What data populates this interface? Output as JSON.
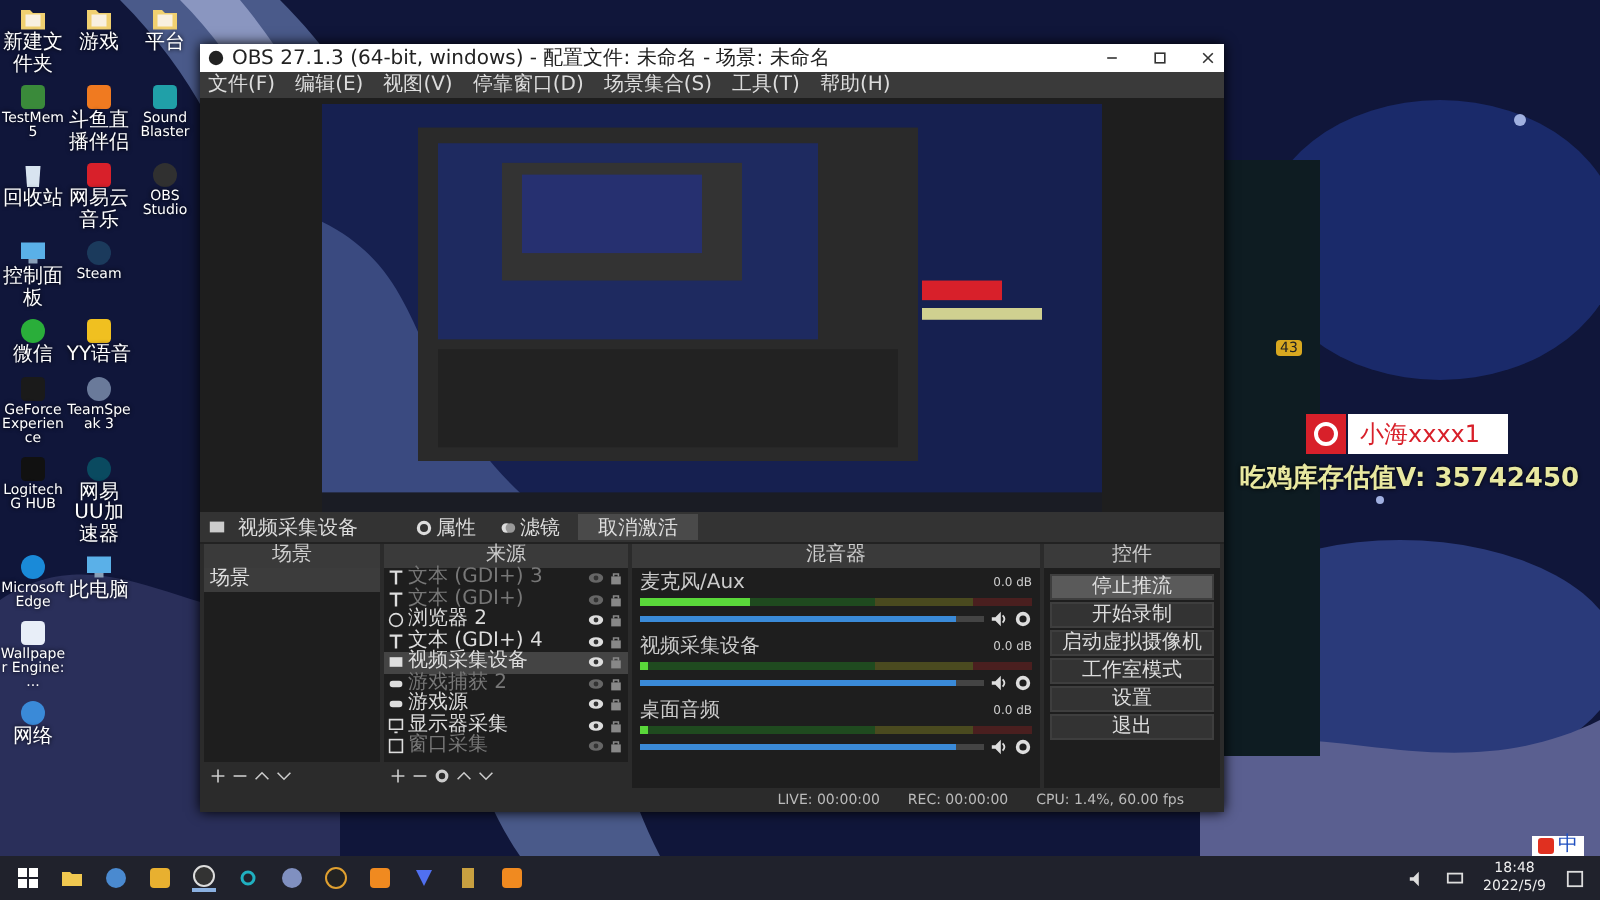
{
  "desktop_rows": [
    [
      {
        "label": "新建文件夹",
        "kind": "folder"
      },
      {
        "label": "游戏",
        "kind": "folder"
      },
      {
        "label": "平台",
        "kind": "folder"
      }
    ],
    [
      {
        "label": "TestMem5",
        "kind": "tile",
        "color": "#3a8a3a"
      },
      {
        "label": "斗鱼直播伴侣",
        "kind": "tile",
        "color": "#f07a20"
      },
      {
        "label": "Sound Blaster",
        "kind": "tile",
        "color": "#20a0a8"
      }
    ],
    [
      {
        "label": "回收站",
        "kind": "bin"
      },
      {
        "label": "网易云音乐",
        "kind": "tile",
        "color": "#d8202a"
      },
      {
        "label": "OBS Studio",
        "kind": "circle",
        "color": "#303030"
      }
    ],
    [
      {
        "label": "控制面板",
        "kind": "monitor"
      },
      {
        "label": "Steam",
        "kind": "circle",
        "color": "#1b3a5c"
      }
    ],
    [
      {
        "label": "微信",
        "kind": "circle",
        "color": "#2aae3a"
      },
      {
        "label": "YY语音",
        "kind": "tile",
        "color": "#f0c020"
      }
    ],
    [
      {
        "label": "GeForce Experience",
        "kind": "tile",
        "color": "#1a1a1a"
      },
      {
        "label": "TeamSpeak 3",
        "kind": "circle",
        "color": "#6a7a9a"
      }
    ],
    [
      {
        "label": "Logitech G HUB",
        "kind": "tile",
        "color": "#111111"
      },
      {
        "label": "网易UU加速器",
        "kind": "circle",
        "color": "#0a4a60"
      }
    ],
    [
      {
        "label": "Microsoft Edge",
        "kind": "circle",
        "color": "#1a8ad8"
      },
      {
        "label": "此电脑",
        "kind": "monitor"
      }
    ],
    [
      {
        "label": "Wallpaper Engine: ...",
        "kind": "tile",
        "color": "#e8eef8"
      }
    ],
    [
      {
        "label": "网络",
        "kind": "network"
      }
    ]
  ],
  "background_app": {
    "badge": "43"
  },
  "overlay": {
    "name": "小海xxxx1",
    "stat": "吃鸡库存估值V: 35742450"
  },
  "obs": {
    "title": "OBS 27.1.3 (64-bit, windows) - 配置文件: 未命名 - 场景: 未命名",
    "menu": [
      "文件(F)",
      "编辑(E)",
      "视图(V)",
      "停靠窗口(D)",
      "场景集合(S)",
      "工具(T)",
      "帮助(H)"
    ],
    "toolbar": {
      "source": "视频采集设备",
      "properties": "属性",
      "filters": "滤镜",
      "deactivate": "取消激活"
    },
    "docks": {
      "scenes": "场景",
      "sources": "来源",
      "mixer": "混音器",
      "controls": "控件"
    },
    "scenes": [
      {
        "label": "场景",
        "selected": true
      }
    ],
    "sources": [
      {
        "label": "文本 (GDI+) 3",
        "kind": "text",
        "visible": false,
        "selected": false
      },
      {
        "label": "文本 (GDI+)",
        "kind": "text",
        "visible": false,
        "selected": false
      },
      {
        "label": "浏览器 2",
        "kind": "browser",
        "visible": true,
        "selected": false
      },
      {
        "label": "文本 (GDI+) 4",
        "kind": "text",
        "visible": true,
        "selected": false
      },
      {
        "label": "视频采集设备",
        "kind": "camera",
        "visible": true,
        "selected": true
      },
      {
        "label": "游戏捕获 2",
        "kind": "game",
        "visible": false,
        "selected": false
      },
      {
        "label": "游戏源",
        "kind": "game",
        "visible": true,
        "selected": false
      },
      {
        "label": "显示器采集",
        "kind": "display",
        "visible": true,
        "selected": false
      },
      {
        "label": "窗口采集",
        "kind": "window",
        "visible": false,
        "selected": false
      }
    ],
    "mixer": [
      {
        "name": "麦克风/Aux",
        "reading": "0.0 dB",
        "meter": {
          "level": 0.28
        },
        "volume": {
          "level": 0.92
        }
      },
      {
        "name": "视频采集设备",
        "reading": "0.0 dB",
        "meter": {
          "level": 0.02
        },
        "volume": {
          "level": 0.92
        }
      },
      {
        "name": "桌面音频",
        "reading": "0.0 dB",
        "meter": {
          "level": 0.02
        },
        "volume": {
          "level": 0.92
        }
      }
    ],
    "controls": [
      {
        "label": "停止推流",
        "selected": true
      },
      {
        "label": "开始录制",
        "selected": false
      },
      {
        "label": "启动虚拟摄像机",
        "selected": false
      },
      {
        "label": "工作室模式",
        "selected": false
      },
      {
        "label": "设置",
        "selected": false
      },
      {
        "label": "退出",
        "selected": false
      }
    ],
    "status": {
      "live": "LIVE: 00:00:00",
      "rec": "REC: 00:00:00",
      "cpu": "CPU: 1.4%, 60.00 fps"
    }
  },
  "tray": {
    "ime": "中",
    "time": "18:48",
    "date": "2022/5/9"
  }
}
